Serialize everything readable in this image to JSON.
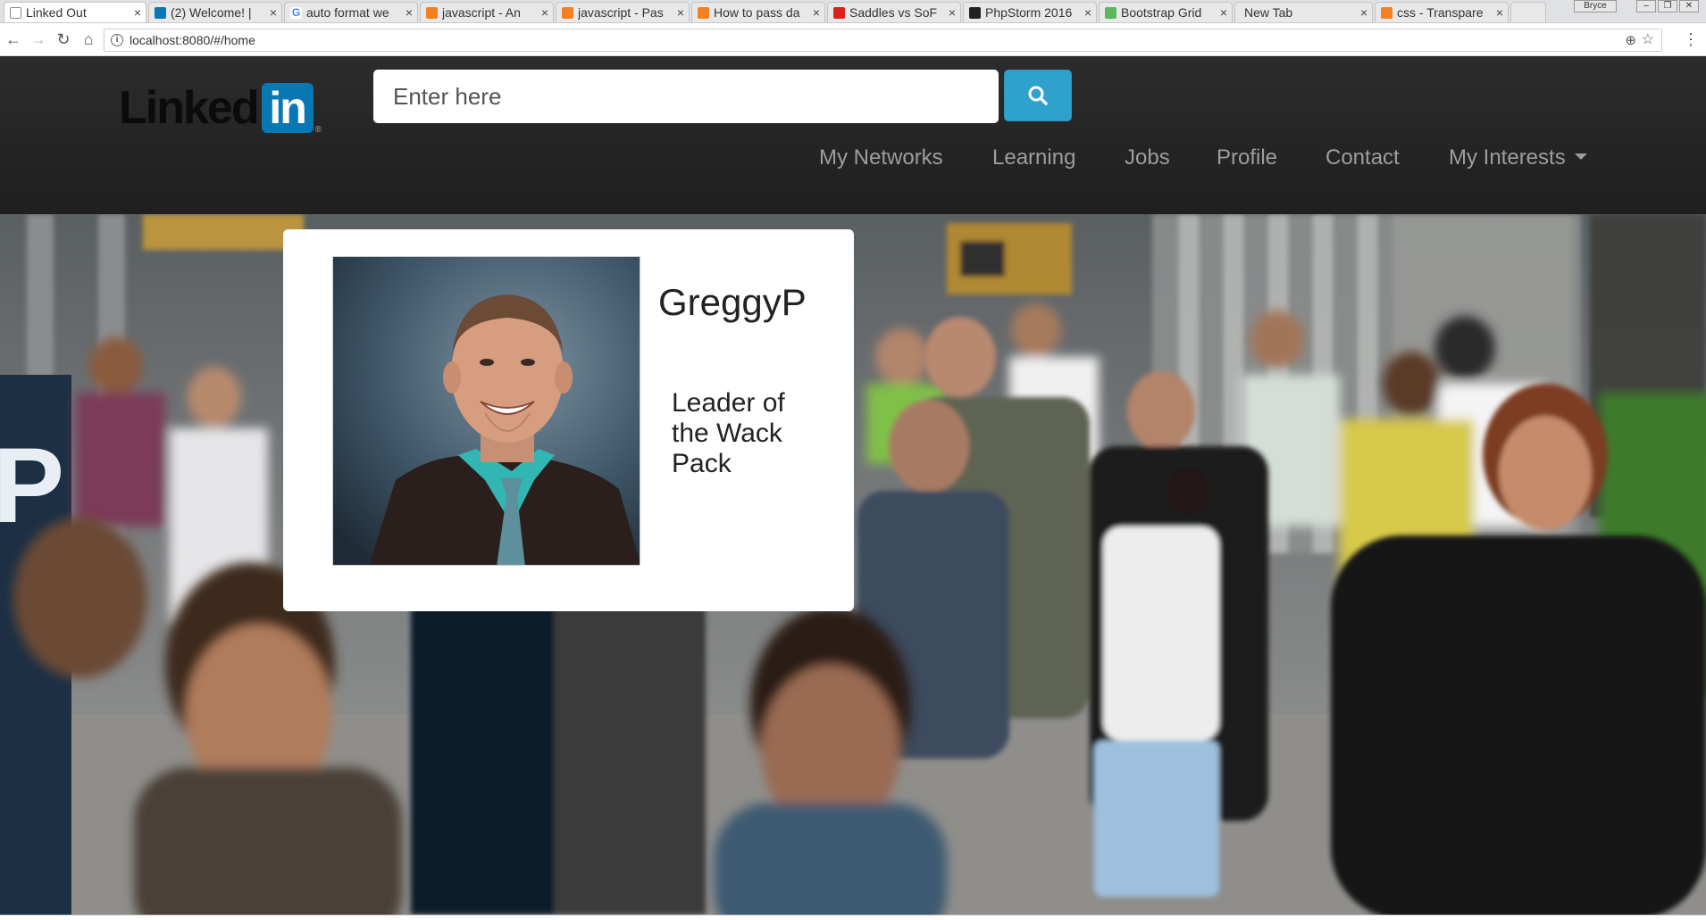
{
  "browser": {
    "tabs": [
      {
        "label": "Linked Out",
        "favicon_color": "#ffffff",
        "active": true
      },
      {
        "label": "(2) Welcome! |",
        "favicon_color": "#0a77b5"
      },
      {
        "label": "auto format we",
        "favicon_color": "#4285f4"
      },
      {
        "label": "javascript - An",
        "favicon_color": "#f48024"
      },
      {
        "label": "javascript - Pas",
        "favicon_color": "#f48024"
      },
      {
        "label": "How to pass da",
        "favicon_color": "#f48024"
      },
      {
        "label": "Saddles vs SoF",
        "favicon_color": "#d9231d"
      },
      {
        "label": "PhpStorm 2016",
        "favicon_color": "#222222"
      },
      {
        "label": "Bootstrap Grid",
        "favicon_color": "#5cb85c"
      },
      {
        "label": "New Tab",
        "favicon_color": ""
      },
      {
        "label": "css - Transpare",
        "favicon_color": "#f48024"
      }
    ],
    "profile_name": "Bryce",
    "url": "localhost:8080/#/home"
  },
  "header": {
    "logo_text": "Linked",
    "logo_box": "in",
    "logo_reg": "®",
    "search_placeholder": "Enter here",
    "nav": [
      {
        "label": "My Networks"
      },
      {
        "label": "Learning"
      },
      {
        "label": "Jobs"
      },
      {
        "label": "Profile"
      },
      {
        "label": "Contact"
      },
      {
        "label": "My Interests"
      }
    ]
  },
  "profile_card": {
    "name": "GreggyP",
    "title": "Leader of the Wack Pack"
  },
  "colors": {
    "header_bg": "#222222",
    "search_button": "#2ea2cd",
    "nav_text": "#9d9d9d",
    "logo_blue": "#0a77b5"
  },
  "icons": {
    "search_button": "search-icon",
    "dropdown": "caret-down-icon",
    "back": "back-arrow-icon",
    "forward": "forward-arrow-icon",
    "reload": "reload-icon",
    "home": "home-icon",
    "bookmark": "star-icon",
    "zoom": "zoom-icon",
    "menu": "menu-dots-icon"
  }
}
